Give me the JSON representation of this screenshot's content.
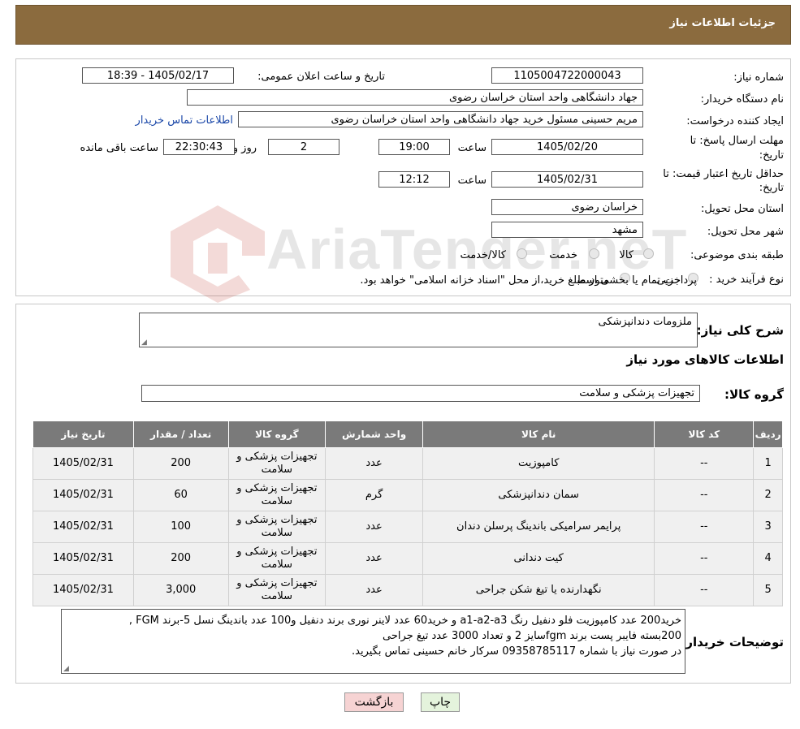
{
  "header": {
    "title": "جزئیات اطلاعات نیاز"
  },
  "form": {
    "need_number_label": "شماره نیاز:",
    "need_number": "1105004722000043",
    "announce_label": "تاریخ و ساعت اعلان عمومی:",
    "announce_value": "1405/02/17 - 18:39",
    "buyer_org_label": "نام دستگاه خریدار:",
    "buyer_org": "جهاد دانشگاهی واحد استان خراسان رضوی",
    "requester_label": "ایجاد کننده درخواست:",
    "requester": "مریم حسینی مسئول خرید جهاد دانشگاهی واحد استان خراسان رضوی",
    "contact_link": "اطلاعات تماس خریدار",
    "deadline_label_1": "مهلت ارسال پاسخ: تا",
    "deadline_label_2": "تاریخ:",
    "deadline_date": "1405/02/20",
    "time_word": "ساعت",
    "deadline_time": "19:00",
    "days_value": "2",
    "days_word": "روز و",
    "remaining_time": "22:30:43",
    "remaining_word": "ساعت باقی مانده",
    "price_valid_label_1": "حداقل تاریخ اعتبار قیمت: تا",
    "price_valid_label_2": "تاریخ:",
    "price_valid_date": "1405/02/31",
    "price_valid_time": "12:12",
    "province_label": "استان محل تحویل:",
    "province": "خراسان رضوی",
    "city_label": "شهر محل تحویل:",
    "city": "مشهد",
    "category_label": "طبقه بندی موضوعی:",
    "category_options": [
      "کالا",
      "خدمت",
      "کالا/خدمت"
    ],
    "process_label": "نوع فرآیند خرید :",
    "process_options": [
      "جزیی",
      "متوسط"
    ],
    "process_note": "پرداخت تمام یا بخشی از مبلغ خرید،از محل \"اسناد خزانه اسلامی\" خواهد بود."
  },
  "general": {
    "desc_label": "شرح کلی نیاز:",
    "desc_value": "ملزومات دندانپزشکی",
    "goods_info_title": "اطلاعات کالاهای مورد نیاز",
    "group_label": "گروه کالا:",
    "group_value": "تجهیزات پزشکی و سلامت"
  },
  "table": {
    "headers": [
      "ردیف",
      "کد کالا",
      "نام کالا",
      "واحد شمارش",
      "گروه کالا",
      "تعداد / مقدار",
      "تاریخ نیاز"
    ],
    "rows": [
      [
        "1",
        "--",
        "کامپوزیت",
        "عدد",
        "تجهیزات پزشکی و سلامت",
        "200",
        "1405/02/31"
      ],
      [
        "2",
        "--",
        "سمان دندانپزشکی",
        "گرم",
        "تجهیزات پزشکی و سلامت",
        "60",
        "1405/02/31"
      ],
      [
        "3",
        "--",
        "پرایمر سرامیکی باندینگ پرسلن دندان",
        "عدد",
        "تجهیزات پزشکی و سلامت",
        "100",
        "1405/02/31"
      ],
      [
        "4",
        "--",
        "کیت دندانی",
        "عدد",
        "تجهیزات پزشکی و سلامت",
        "200",
        "1405/02/31"
      ],
      [
        "5",
        "--",
        "نگهدارنده یا تیغ شکن جراحی",
        "عدد",
        "تجهیزات پزشکی و سلامت",
        "3,000",
        "1405/02/31"
      ]
    ]
  },
  "notes": {
    "label": "توضیحات خریدار:",
    "line1": "خرید200 عدد کامپوزیت فلو دنفیل رنگ a1-a2-a3 و خرید60 عدد لاینر نوری برند دنفیل و100 عدد باندینگ نسل 5-برند FGM ,",
    "line2": "200بسته فایبر پست برند fgmسایز 2 و تعداد 3000 عدد تیغ جراحی",
    "line3": "در صورت نیاز با شماره 09358785117 سرکار خانم حسینی تماس بگیرید."
  },
  "buttons": {
    "print": "چاپ",
    "back": "بازگشت"
  },
  "watermark": {
    "text": "AriaTender.neT"
  },
  "colors": {
    "header": "#8b6b3e",
    "table_header": "#7a7a7a",
    "link": "#1a47a8",
    "back_button": "#f6d3d3",
    "print_button": "#e4f3dc"
  }
}
